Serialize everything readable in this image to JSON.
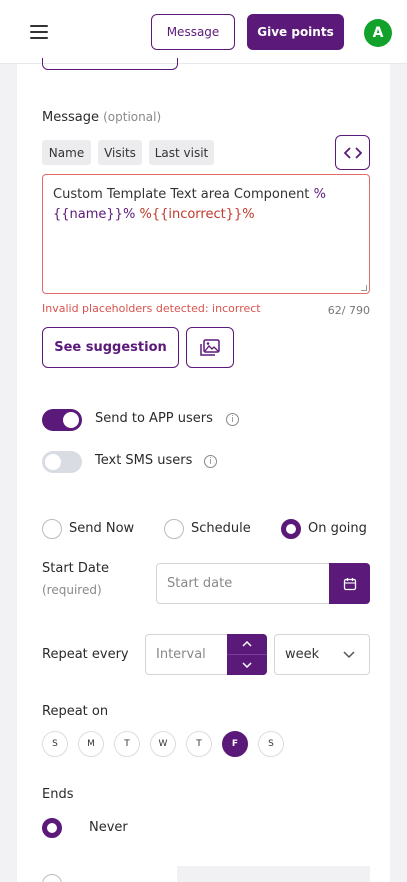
{
  "header": {
    "message_label": "Message",
    "give_points_label": "Give points",
    "avatar_letter": "A"
  },
  "message": {
    "label": "Message",
    "optional": "(optional)",
    "placeholders": [
      "Name",
      "Visits",
      "Last visit"
    ],
    "text_static": "Custom Template Text area Component",
    "text_ph1": "%",
    "text_ph2": "{{name}}%",
    "text_ph3": "%{{incorrect}}%",
    "error": "Invalid placeholders detected: incorrect",
    "count": "62/ 790",
    "suggestion_label": "See suggestion"
  },
  "toggles": [
    {
      "label": "Send to APP users",
      "on": true
    },
    {
      "label": "Text SMS users",
      "on": false
    }
  ],
  "schedule": {
    "options": [
      "Send Now",
      "Schedule",
      "On going"
    ],
    "selected": "On going"
  },
  "start_date": {
    "label": "Start Date",
    "required": "(required)",
    "placeholder": "Start date"
  },
  "repeat_every": {
    "label": "Repeat every",
    "interval_placeholder": "Interval",
    "unit": "week"
  },
  "repeat_on": {
    "label": "Repeat on",
    "days": [
      "S",
      "M",
      "T",
      "W",
      "T",
      "F",
      "S"
    ],
    "selected_index": 5
  },
  "ends": {
    "label": "Ends",
    "never_label": "Never"
  },
  "colors": {
    "accent": "#5b1a7a",
    "error": "#d9534f",
    "avatar": "#12a12a"
  }
}
